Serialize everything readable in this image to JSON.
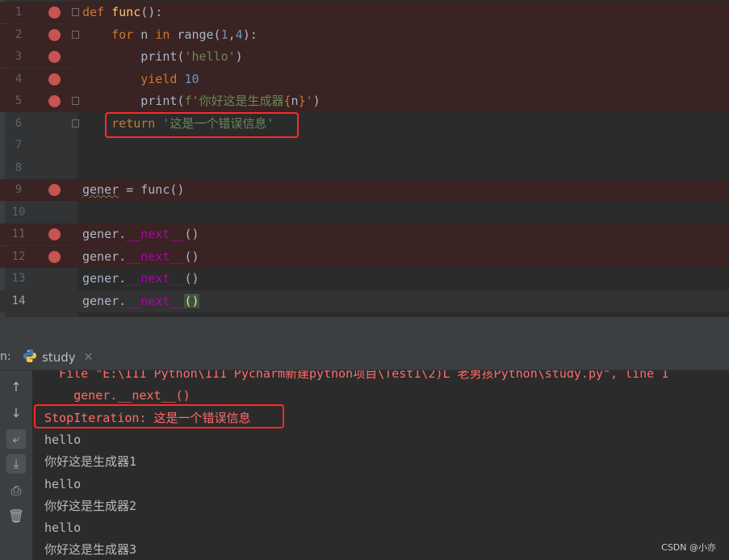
{
  "editor": {
    "lines": [
      {
        "num": "1",
        "breakpoint": true,
        "fold": true,
        "tokens": [
          [
            "kw",
            "def "
          ],
          [
            "fn",
            "func"
          ],
          [
            "plain",
            "():"
          ]
        ]
      },
      {
        "num": "2",
        "breakpoint": true,
        "fold": true,
        "tokens": [
          [
            "plain",
            "    "
          ],
          [
            "kw",
            "for "
          ],
          [
            "plain",
            "n "
          ],
          [
            "kw",
            "in "
          ],
          [
            "plain",
            "range("
          ],
          [
            "num",
            "1"
          ],
          [
            "plain",
            ","
          ],
          [
            "num",
            "4"
          ],
          [
            "plain",
            "):"
          ]
        ]
      },
      {
        "num": "3",
        "breakpoint": true,
        "fold": false,
        "tokens": [
          [
            "plain",
            "        "
          ],
          [
            "plain",
            "print("
          ],
          [
            "str",
            "'hello'"
          ],
          [
            "plain",
            ")"
          ]
        ]
      },
      {
        "num": "4",
        "breakpoint": true,
        "fold": false,
        "tokens": [
          [
            "plain",
            "        "
          ],
          [
            "kw",
            "yield "
          ],
          [
            "num",
            "10"
          ]
        ]
      },
      {
        "num": "5",
        "breakpoint": true,
        "fold": true,
        "tokens": [
          [
            "plain",
            "        "
          ],
          [
            "plain",
            "print("
          ],
          [
            "str",
            "f'你好这是生成器"
          ],
          [
            "kw",
            "{"
          ],
          [
            "plain",
            "n"
          ],
          [
            "kw",
            "}"
          ],
          [
            "str",
            "'"
          ],
          [
            "plain",
            ")"
          ]
        ]
      },
      {
        "num": "6",
        "breakpoint": false,
        "fold": true,
        "tokens": [
          [
            "plain",
            "    "
          ],
          [
            "kw",
            "return "
          ],
          [
            "str",
            "'这是一个错误信息'"
          ]
        ]
      },
      {
        "num": "7",
        "breakpoint": false,
        "fold": false,
        "tokens": []
      },
      {
        "num": "8",
        "breakpoint": false,
        "fold": false,
        "tokens": []
      },
      {
        "num": "9",
        "breakpoint": true,
        "fold": false,
        "tokens": [
          [
            "plain",
            "gener"
          ],
          [
            "plain",
            " = func()"
          ]
        ]
      },
      {
        "num": "10",
        "breakpoint": false,
        "fold": false,
        "tokens": []
      },
      {
        "num": "11",
        "breakpoint": true,
        "fold": false,
        "tokens": [
          [
            "plain",
            "gener."
          ],
          [
            "dunder",
            "__next__"
          ],
          [
            "plain",
            "()"
          ]
        ]
      },
      {
        "num": "12",
        "breakpoint": true,
        "fold": false,
        "tokens": [
          [
            "plain",
            "gener."
          ],
          [
            "dunder",
            "__next__"
          ],
          [
            "plain",
            "()"
          ]
        ]
      },
      {
        "num": "13",
        "breakpoint": false,
        "fold": false,
        "tokens": [
          [
            "plain",
            "gener."
          ],
          [
            "dunder",
            "__next__"
          ],
          [
            "plain",
            "()"
          ]
        ]
      },
      {
        "num": "14",
        "breakpoint": false,
        "fold": false,
        "current": true,
        "tokens": [
          [
            "plain",
            "gener."
          ],
          [
            "dunder",
            "__next__"
          ],
          [
            "hlparen",
            "()"
          ]
        ]
      }
    ]
  },
  "run_panel": {
    "side_label": "n:",
    "tab_label": "study",
    "close_glyph": "✕",
    "console_lines": [
      {
        "cls": "err",
        "text": "  File \"E:\\111 Python\\111 Pycharm新建python项目\\Test1\\2)L 老男孩Python\\study.py\", line 1"
      },
      {
        "cls": "err",
        "text": "    gener.__next__()"
      },
      {
        "cls": "err",
        "text": "StopIteration: 这是一个错误信息"
      },
      {
        "cls": "out",
        "text": "hello"
      },
      {
        "cls": "out",
        "text": "你好这是生成器1"
      },
      {
        "cls": "out",
        "text": "hello"
      },
      {
        "cls": "out",
        "text": "你好这是生成器2"
      },
      {
        "cls": "out",
        "text": "hello"
      },
      {
        "cls": "out",
        "text": "你好这是生成器3"
      }
    ],
    "toolbar": [
      {
        "name": "scroll-up-icon",
        "glyph": "↑"
      },
      {
        "name": "scroll-down-icon",
        "glyph": "↓"
      },
      {
        "name": "soft-wrap-icon",
        "glyph": "⤶"
      },
      {
        "name": "scroll-to-end-icon",
        "glyph": "⤓"
      },
      {
        "name": "print-icon",
        "glyph": "⎙"
      },
      {
        "name": "trash-icon",
        "glyph": "🗑"
      }
    ]
  },
  "watermark": "CSDN @小亦",
  "colors": {
    "keyword": "#cc7832",
    "function": "#ffc66d",
    "string": "#6a8759",
    "number": "#6897bb",
    "dunder": "#b200b2",
    "error_text": "#ff6b68",
    "breakpoint": "#c75450",
    "highlight_box": "#ff2a2a"
  }
}
